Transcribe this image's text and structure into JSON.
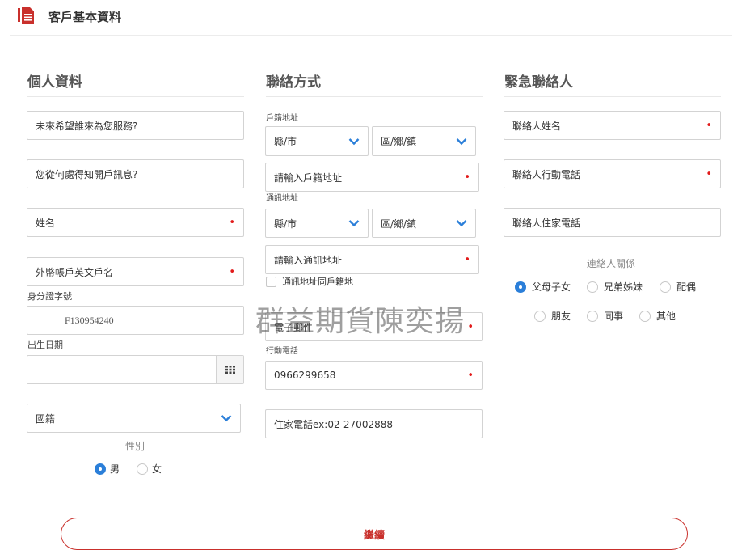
{
  "header": {
    "title": "客戶基本資料",
    "icon": "document-icon"
  },
  "colors": {
    "accent_red": "#c9302c",
    "required_red": "#e21a1a",
    "radio_blue": "#2b7fd9",
    "chevron_blue": "#2b7fd9"
  },
  "personal": {
    "title": "個人資料",
    "service_person_placeholder": "未來希望誰來為您服務?",
    "how_know_placeholder": "您從何處得知開戶訊息?",
    "name_placeholder": "姓名",
    "english_name_placeholder": "外幣帳戶英文戶名",
    "id_label": "身分證字號",
    "id_value": "F130954240",
    "birth_label": "出生日期",
    "nationality_value": "國籍",
    "gender_label": "性別",
    "gender_male": "男",
    "gender_female": "女"
  },
  "contact": {
    "title": "聯絡方式",
    "household_label": "戶籍地址",
    "county_select": "縣/市",
    "district_select": "區/鄉/鎮",
    "household_address_placeholder": "請輸入戶籍地址",
    "mailing_label": "通訊地址",
    "county_select_2": "縣/市",
    "district_select_2": "區/鄉/鎮",
    "mailing_address_placeholder": "請輸入通訊地址",
    "same_address_label": "通訊地址同戶籍地",
    "email_placeholder": "電子郵件",
    "mobile_label": "行動電話",
    "mobile_value": "0966299658",
    "home_phone_placeholder": "住家電話ex:02-27002888"
  },
  "emergency": {
    "title": "緊急聯絡人",
    "contact_name_placeholder": "聯絡人姓名",
    "contact_mobile_placeholder": "聯絡人行動電話",
    "contact_home_placeholder": "聯絡人住家電話",
    "relation_label": "連絡人關係",
    "relations": [
      "父母子女",
      "兄弟姊妹",
      "配偶",
      "朋友",
      "同事",
      "其他"
    ]
  },
  "required_mark": "•",
  "continue_label": "繼續",
  "watermark": "群益期貨陳奕揚"
}
